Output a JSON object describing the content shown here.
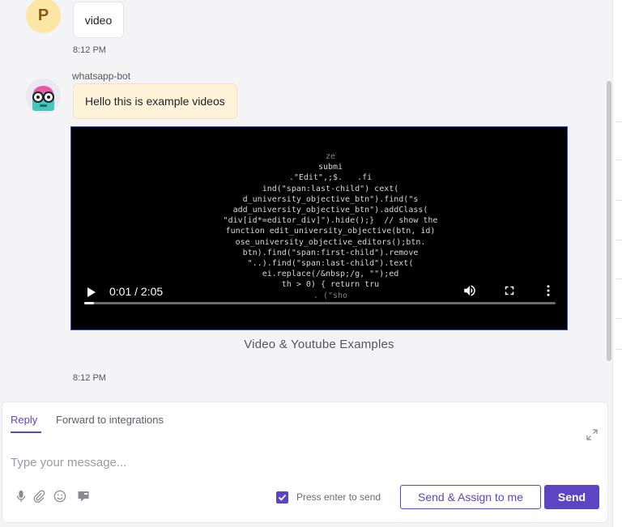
{
  "messages": [
    {
      "sender": "",
      "avatar_letter": "P",
      "text": "video",
      "time": "8:12 PM"
    },
    {
      "sender": "whatsapp-bot",
      "text": "Hello this is example videos",
      "time": "8:12 PM"
    }
  ],
  "video": {
    "time_display": "0:01 / 2:05",
    "progress_fraction": 0.008,
    "caption": "Video & Youtube Examples",
    "frame_lines": [
      "ze",
      "submi",
      ".\"Edit\",;$.   .fi",
      "ind(\"span:last-child\") cext(",
      "d_university_objective_btn\").find(\"s",
      "add_university_objective_btn\").addClass(",
      "\"div[id*=editor_div]\").hide();}  // show the",
      "function edit_university_objective(btn, id)",
      "ose_university_objective_editors();btn.",
      "btn).find(\"span:first-child\").remove",
      "\"..).find(\"span:last-child\").text(",
      "ei.replace(/&nbsp;/g, \"\");ed",
      "th > 0) { return tru",
      ". (\"sho"
    ]
  },
  "reply": {
    "tabs": [
      "Reply",
      "Forward to integrations"
    ],
    "placeholder": "Type your message...",
    "press_enter_label": "Press enter to send",
    "press_enter_checked": true,
    "assign_button": "Send & Assign to me",
    "send_button": "Send"
  },
  "icons": {
    "mic": "microphone-icon",
    "attach": "paperclip-icon",
    "emoji": "emoji-icon",
    "canned": "canned-response-icon",
    "expand": "expand-icon"
  },
  "colors": {
    "accent": "#5b45c2",
    "bot_bubble": "#fff4d9",
    "user_avatar": "#fce6a6"
  }
}
